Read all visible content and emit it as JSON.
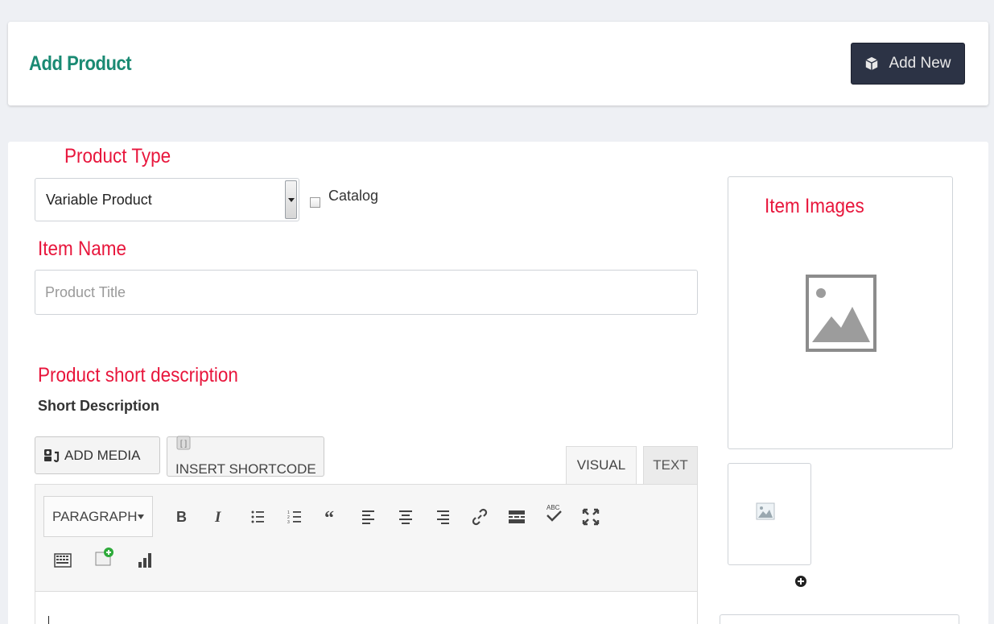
{
  "header": {
    "title": "Add Product",
    "add_new_label": "Add New"
  },
  "annotations": {
    "product_type": "Product Type",
    "item_name": "Item Name",
    "short_description": "Product short description",
    "item_images": "Item Images"
  },
  "product_type": {
    "selected": "Variable Product",
    "catalog_label": "Catalog",
    "catalog_checked": false
  },
  "item_name": {
    "placeholder": "Product Title",
    "value": ""
  },
  "short_description": {
    "label": "Short Description",
    "add_media_label": "ADD MEDIA",
    "insert_shortcode_label": "INSERT SHORTCODE",
    "tabs": [
      {
        "label": "VISUAL",
        "active": true
      },
      {
        "label": "TEXT",
        "active": false
      }
    ],
    "format_select": "PARAGRAPH",
    "toolbar_icons": [
      "bold-icon",
      "italic-icon",
      "bulleted-list-icon",
      "numbered-list-icon",
      "blockquote-icon",
      "align-left-icon",
      "align-center-icon",
      "align-right-icon",
      "link-icon",
      "read-more-icon",
      "spellcheck-icon",
      "fullscreen-icon",
      "toolbar-toggle-icon",
      "add-note-icon",
      "chart-icon"
    ]
  },
  "colors": {
    "title": "#1a8a73",
    "annotation": "#e8163c",
    "button_dark": "#2c3345"
  }
}
